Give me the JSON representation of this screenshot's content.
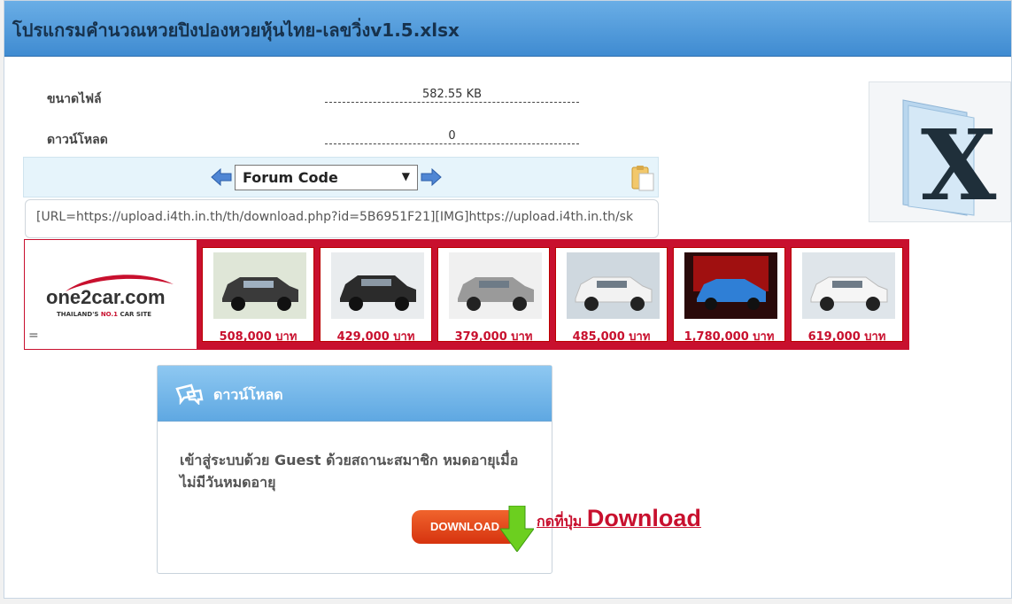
{
  "header": {
    "title": "โปรแกรมคำนวณหวยปิงปองหวยหุ้นไทย-เลขวิ่งv1.5.xlsx"
  },
  "file_info": {
    "size_label": "ขนาดไฟล์",
    "size_value": "582.55 KB",
    "downloads_label": "ดาวน์โหลด",
    "downloads_value": "0"
  },
  "code_bar": {
    "selected_format": "Forum Code",
    "code_value": "[URL=https://upload.i4th.in.th/th/download.php?id=5B6951F21][IMG]https://upload.i4th.in.th/sk"
  },
  "ad": {
    "brand": "one2car",
    "brand_suffix": ".com",
    "tagline_pre": "THAILAND'S ",
    "tagline_highlight": "NO.1",
    "tagline_post": " CAR SITE",
    "menu_glyph": "=",
    "cars": [
      {
        "price": "508,000 บาท",
        "color": "#3a3a3a"
      },
      {
        "price": "429,000 บาท",
        "color": "#2b2b2b"
      },
      {
        "price": "379,000 บาท",
        "color": "#9a9a9a"
      },
      {
        "price": "485,000 บาท",
        "color": "#f2f2f2"
      },
      {
        "price": "1,780,000 บาท",
        "color": "#2f7fd6"
      },
      {
        "price": "619,000 บาท",
        "color": "#f5f5f5"
      }
    ],
    "accent": "#c8102e"
  },
  "download": {
    "title": "ดาวน์โหลด",
    "message": "เข้าสู่ระบบด้วย Guest ด้วยสถานะสมาชิก หมดอายุเมื่อ ไม่มีวันหมดอายุ",
    "button_label": "DOWNLOAD",
    "note_thai": "กดที่ปุ่ม ",
    "note_english": "Download"
  }
}
